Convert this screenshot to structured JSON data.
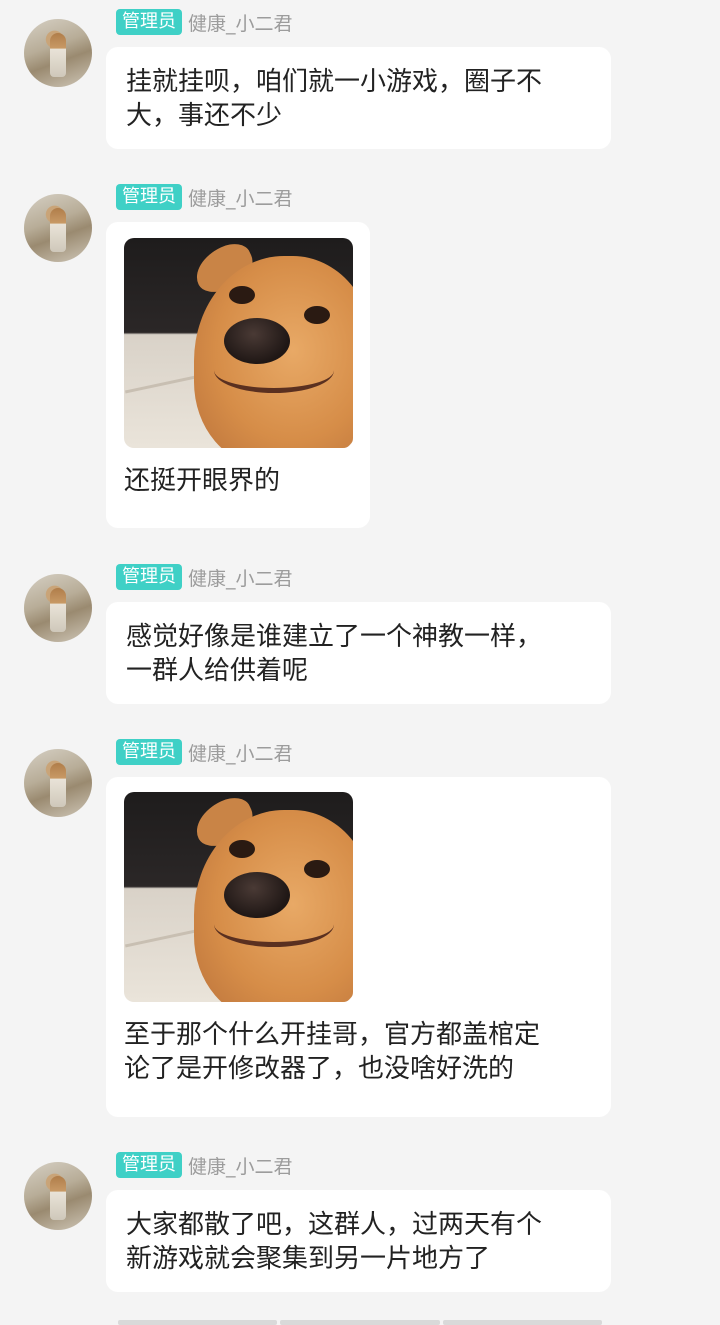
{
  "messages": [
    {
      "badge": "管理员",
      "user": "健康_小二君",
      "text": "挂就挂呗，咱们就一小游戏，圈子不\n大，事还不少"
    },
    {
      "badge": "管理员",
      "user": "健康_小二君",
      "text": "还挺开眼界的",
      "sticker": "smiling-dog-sticker"
    },
    {
      "badge": "管理员",
      "user": "健康_小二君",
      "text": "感觉好像是谁建立了一个神教一样，\n一群人给供着呢"
    },
    {
      "badge": "管理员",
      "user": "健康_小二君",
      "text": "至于那个什么开挂哥，官方都盖棺定\n论了是开修改器了，也没啥好洗的",
      "sticker": "smiling-dog-sticker"
    },
    {
      "badge": "管理员",
      "user": "健康_小二君",
      "text": "大家都散了吧，这群人，过两天有个\n新游戏就会聚集到另一片地方了"
    }
  ],
  "colors": {
    "badge": "#3fd0c6",
    "background": "#f4f4f4",
    "bubble": "#ffffff",
    "username": "#9c9c9c"
  }
}
